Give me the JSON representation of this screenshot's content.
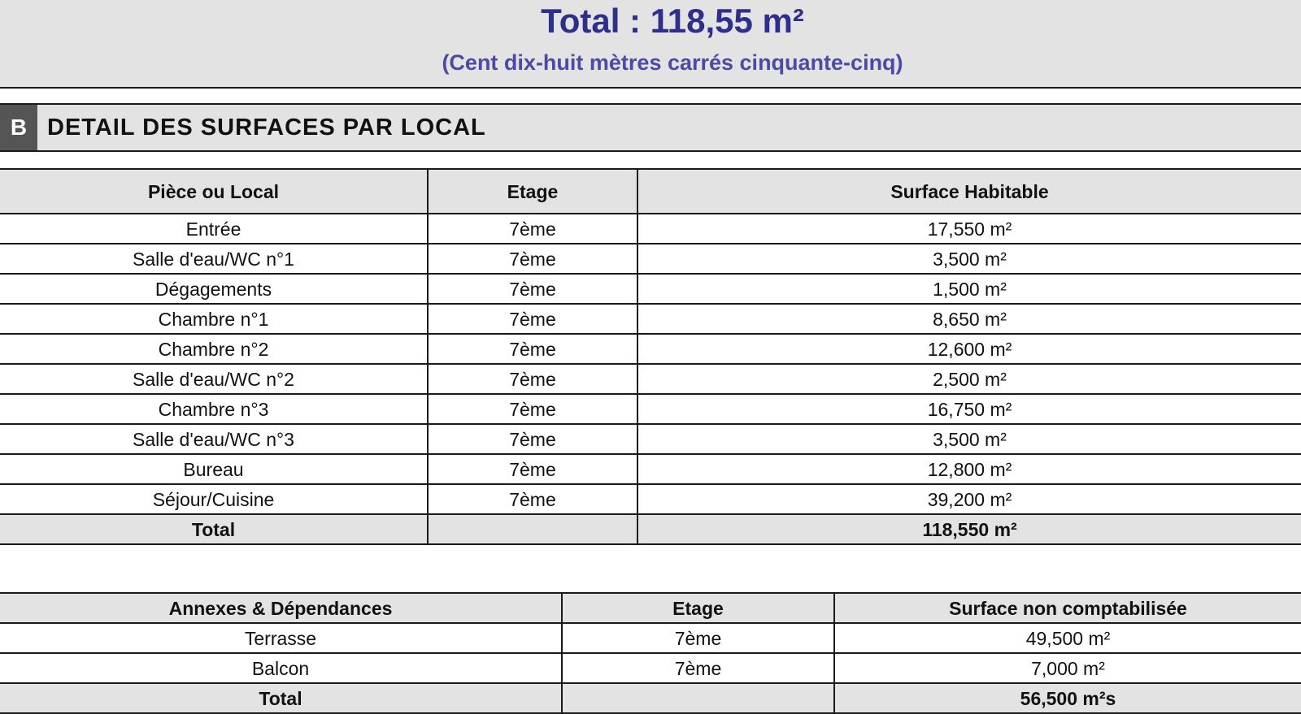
{
  "summary": {
    "total_title": "Total : 118,55 m²",
    "total_words": "(Cent dix-huit mètres carrés cinquante-cinq)"
  },
  "section": {
    "letter": "B",
    "title": "DETAIL DES SURFACES PAR LOCAL"
  },
  "rooms_table": {
    "headers": [
      "Pièce ou Local",
      "Etage",
      "Surface Habitable"
    ],
    "rows": [
      [
        "Entrée",
        "7ème",
        "17,550 m²"
      ],
      [
        "Salle d'eau/WC n°1",
        "7ème",
        "3,500 m²"
      ],
      [
        "Dégagements",
        "7ème",
        "1,500 m²"
      ],
      [
        "Chambre n°1",
        "7ème",
        "8,650 m²"
      ],
      [
        "Chambre n°2",
        "7ème",
        "12,600 m²"
      ],
      [
        "Salle d'eau/WC n°2",
        "7ème",
        "2,500 m²"
      ],
      [
        "Chambre n°3",
        "7ème",
        "16,750 m²"
      ],
      [
        "Salle d'eau/WC n°3",
        "7ème",
        "3,500 m²"
      ],
      [
        "Bureau",
        "7ème",
        "12,800 m²"
      ],
      [
        "Séjour/Cuisine",
        "7ème",
        "39,200 m²"
      ]
    ],
    "total": [
      "Total",
      "",
      "118,550 m²"
    ]
  },
  "annexes_table": {
    "headers": [
      "Annexes & Dépendances",
      "Etage",
      "Surface non comptabilisée"
    ],
    "rows": [
      [
        "Terrasse",
        "7ème",
        "49,500 m²"
      ],
      [
        "Balcon",
        "7ème",
        "7,000 m²"
      ]
    ],
    "total": [
      "Total",
      "",
      "56,500 m²s"
    ]
  }
}
